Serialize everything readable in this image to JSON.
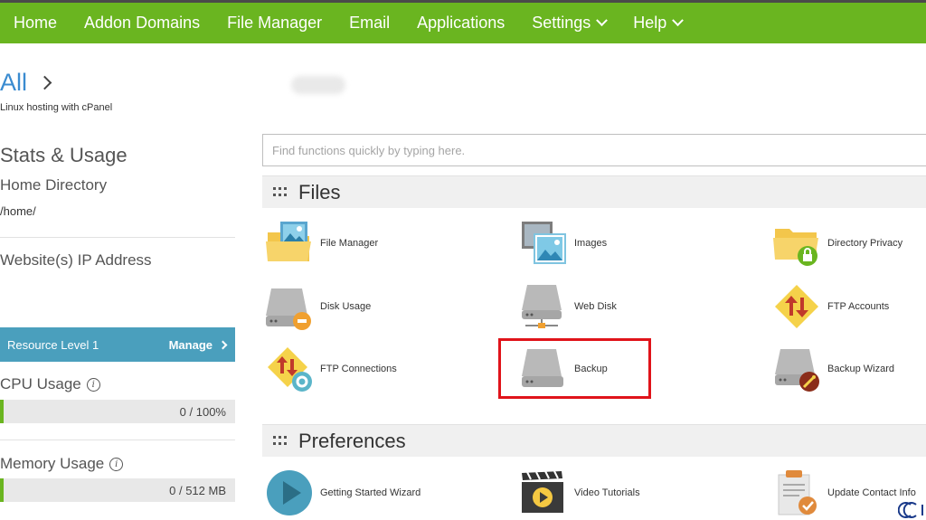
{
  "nav": {
    "items": [
      {
        "label": "Home",
        "dropdown": false
      },
      {
        "label": "Addon Domains",
        "dropdown": false
      },
      {
        "label": "File Manager",
        "dropdown": false
      },
      {
        "label": "Email",
        "dropdown": false
      },
      {
        "label": "Applications",
        "dropdown": false
      },
      {
        "label": "Settings",
        "dropdown": true
      },
      {
        "label": "Help",
        "dropdown": true
      }
    ]
  },
  "sidebar": {
    "all_link": "All",
    "hosting_type": "Linux hosting with cPanel",
    "stats_title": "Stats & Usage",
    "home_dir_label": "Home Directory",
    "home_dir_value": "/home/",
    "ip_label": "Website(s) IP Address",
    "resource_level": "Resource Level 1",
    "manage_label": "Manage",
    "cpu_label": "CPU Usage",
    "cpu_value": "0 / 100%",
    "memory_label": "Memory Usage",
    "memory_value": "0 / 512 MB"
  },
  "search": {
    "placeholder": "Find functions quickly by typing here."
  },
  "sections": {
    "files": {
      "title": "Files",
      "items": [
        {
          "label": "File Manager",
          "icon": "folder-image-icon"
        },
        {
          "label": "Images",
          "icon": "images-icon"
        },
        {
          "label": "Directory Privacy",
          "icon": "folder-lock-icon"
        },
        {
          "label": "Disk Usage",
          "icon": "disk-usage-icon"
        },
        {
          "label": "Web Disk",
          "icon": "web-disk-icon"
        },
        {
          "label": "FTP Accounts",
          "icon": "ftp-accounts-icon"
        },
        {
          "label": "FTP Connections",
          "icon": "ftp-connections-icon"
        },
        {
          "label": "Backup",
          "icon": "backup-icon"
        },
        {
          "label": "Backup Wizard",
          "icon": "backup-wizard-icon"
        }
      ]
    },
    "preferences": {
      "title": "Preferences",
      "items": [
        {
          "label": "Getting Started Wizard",
          "icon": "play-icon"
        },
        {
          "label": "Video Tutorials",
          "icon": "video-tutorials-icon"
        },
        {
          "label": "Update Contact Info",
          "icon": "contact-info-icon"
        }
      ]
    }
  },
  "colors": {
    "nav_bg": "#6ab520",
    "link_blue": "#3a8bd0",
    "resource_bar": "#4a9fbd",
    "highlight": "#e0131a"
  }
}
